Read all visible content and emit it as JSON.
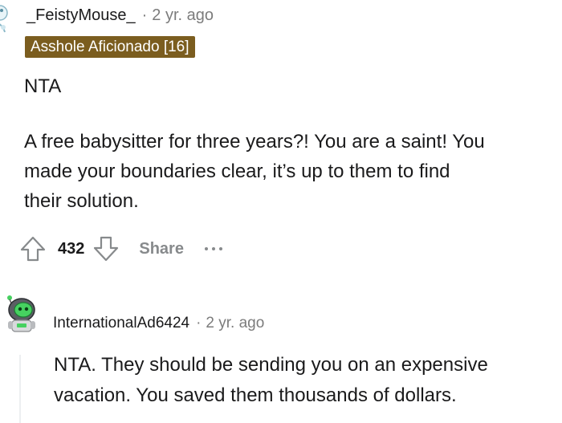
{
  "comments": [
    {
      "username": "_FeistyMouse_",
      "separator": "·",
      "age": "2 yr. ago",
      "flair": "Asshole Aficionado [16]",
      "flair_color": "#7b5d1f",
      "body_line1": "NTA",
      "body_lines": [
        "A free babysitter for three years?! You are a saint! You",
        "made your boundaries clear, it’s up to them to find",
        "their solution."
      ],
      "vote_count": "432",
      "share_label": "Share",
      "more_icon": "ellipsis-icon",
      "upvote_icon": "upvote-arrow-icon",
      "downvote_icon": "downvote-arrow-icon"
    },
    {
      "username": "InternationalAd6424",
      "separator": "·",
      "age": "2 yr. ago",
      "body_lines": [
        "NTA. They should be sending you on an expensive",
        "vacation. You saved them thousands of dollars."
      ]
    }
  ],
  "colors": {
    "text": "#1a1a1b",
    "muted": "#7c7c7c",
    "action": "#878a8c",
    "avatar_green": "#46d160"
  }
}
